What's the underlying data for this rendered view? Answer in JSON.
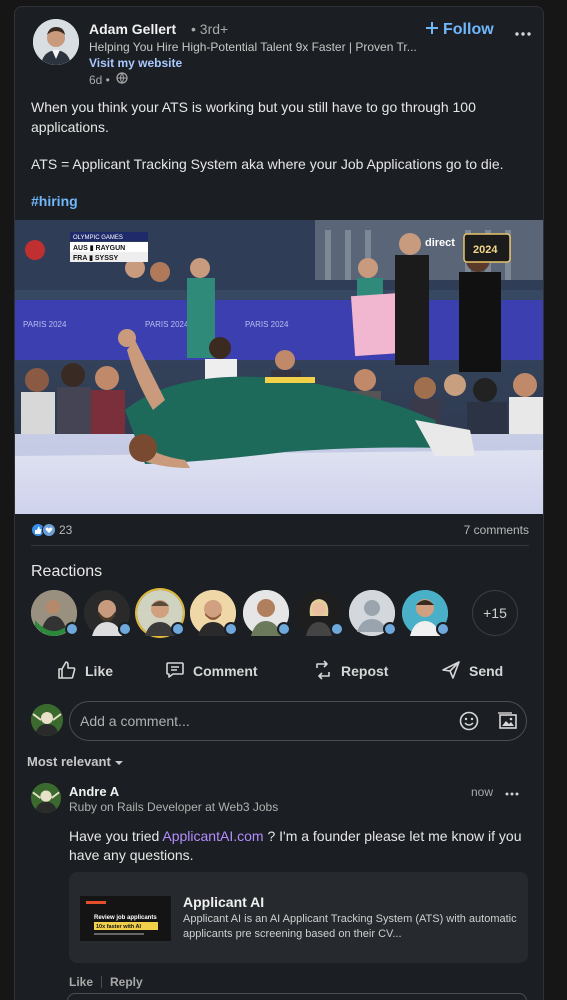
{
  "author": {
    "name": "Adam Gellert",
    "degree": "• 3rd+",
    "headline": "Helping You Hire High-Potential Talent 9x Faster | Proven Tr...",
    "website_link": "Visit my website",
    "post_age": "6d •",
    "visibility_icon": "globe-icon"
  },
  "follow_label": "Follow",
  "more_icon": "more-horizontal-icon",
  "post": {
    "paragraph_1": "When you think your ATS is working but you still have to go through 100 applications.",
    "paragraph_2": "ATS = Applicant Tracking System aka where your Job Applications go to die.",
    "hashtag": "#hiring"
  },
  "media": {
    "scoreboard_event": "OLYMPIC GAMES",
    "scoreboard_row_1": "AUS ▮ RAYGUN",
    "scoreboard_row_2": "FRA ▮ SYSSY",
    "board_text": "PARIS 2024",
    "broadcast_label": "direct",
    "broadcast_year": "2024"
  },
  "social": {
    "reaction_icons": [
      "like-icon",
      "support-icon"
    ],
    "reaction_count": "23",
    "comments_count": "7 comments"
  },
  "reactions": {
    "title": "Reactions",
    "more_label": "+15"
  },
  "actions": {
    "like": "Like",
    "comment": "Comment",
    "repost": "Repost",
    "send": "Send"
  },
  "comment_input": {
    "placeholder": "Add a comment..."
  },
  "sort": {
    "label": "Most relevant"
  },
  "comment": {
    "name": "Andre A",
    "headline": "Ruby on Rails Developer at Web3 Jobs",
    "time": "now",
    "text_before": "Have you tried ",
    "link": "ApplicantAI.com",
    "text_after": " ? I'm a founder please let me know if you have any questions.",
    "preview_title": "Applicant AI",
    "preview_description": "Applicant AI is an AI Applicant Tracking System (ATS) with automatic applicants pre screening based on their CV...",
    "preview_thumb_line_1": "Review job applicants",
    "preview_thumb_line_2": "10x faster with AI",
    "like_label": "Like",
    "reply_label": "Reply"
  },
  "colors": {
    "background": "#1b1f23",
    "accent_blue": "#71b7fb",
    "link_purple": "#b48cff"
  }
}
